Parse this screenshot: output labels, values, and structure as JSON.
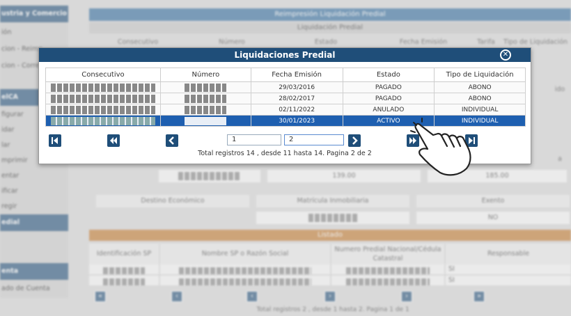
{
  "sidebar": {
    "items": [
      "ustria y Comercio",
      "ión",
      "cion - Reimp",
      "cion - Corre",
      "elCA",
      "figurar",
      "idar",
      "lar",
      "mprimir",
      "entar",
      "ificar",
      "regir",
      "edial",
      "enta",
      "ado de Cuenta"
    ]
  },
  "background": {
    "title": "Reimpresión Liquidación Predial",
    "subtitle": "Liquidación Predial",
    "header_cols": [
      "Consecutivo",
      "Número",
      "Estado",
      "Fecha Emisión",
      "Tarifa",
      "Tipo de Liquidación"
    ],
    "side_text": [
      "ido",
      "a"
    ],
    "values": [
      "139.00",
      "185.00"
    ],
    "labels": [
      "Destino Económico",
      "Matrícula Inmobiliaria",
      "Exento"
    ],
    "exento_value": "NO",
    "listado": "Listado",
    "list_cols": [
      "Identificación SP",
      "Nombre SP o Razón Social",
      "Numero Predial Nacional/Cédula Catastral",
      "Responsable"
    ],
    "resp_values": [
      "SI",
      "SI"
    ],
    "footer": "Total registros 2 , desde 1 hasta 2. Pagina 1 de 1"
  },
  "modal": {
    "title": "Liquidaciones Predial",
    "columns": [
      "Consecutivo",
      "Número",
      "Fecha Emisión",
      "Estado",
      "Tipo de Liquidación"
    ],
    "rows": [
      {
        "fecha": "29/03/2016",
        "estado": "PAGADO",
        "tipo": "ABONO"
      },
      {
        "fecha": "28/02/2017",
        "estado": "PAGADO",
        "tipo": "ABONO"
      },
      {
        "fecha": "02/11/2022",
        "estado": "ANULADO",
        "tipo": "INDIVIDUAL"
      },
      {
        "fecha": "30/01/2023",
        "estado": "ACTIVO",
        "tipo": "INDIVIDUAL"
      }
    ],
    "pager": {
      "page_prev": "1",
      "page_current": "2"
    },
    "footer": "Total registros 14 , desde 11 hasta 14. Pagina 2 de 2"
  },
  "colors": {
    "header": "#1f4e79",
    "selected_row": "#1e5fb0",
    "listado": "#c57a2c"
  }
}
